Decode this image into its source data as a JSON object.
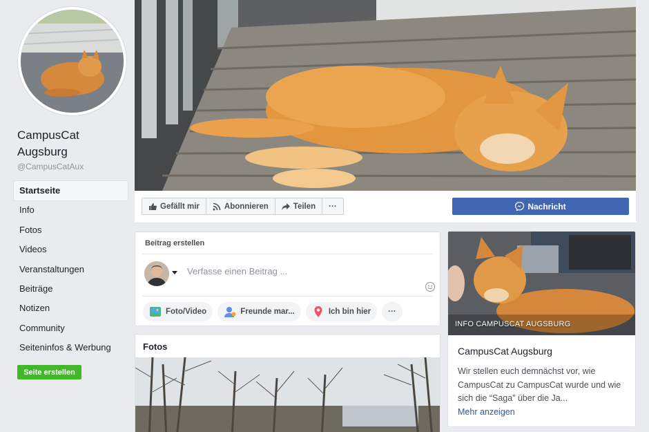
{
  "page": {
    "name": "CampusCat Augsburg",
    "handle": "@CampusCatAux"
  },
  "sidebar": {
    "items": [
      {
        "label": "Startseite",
        "active": true
      },
      {
        "label": "Info"
      },
      {
        "label": "Fotos"
      },
      {
        "label": "Videos"
      },
      {
        "label": "Veranstaltungen"
      },
      {
        "label": "Beiträge"
      },
      {
        "label": "Notizen"
      },
      {
        "label": "Community"
      },
      {
        "label": "Seiteninfos & Werbung"
      }
    ],
    "create_button": "Seite erstellen"
  },
  "actions": {
    "like": "Gefällt mir",
    "follow": "Abonnieren",
    "share": "Teilen",
    "more": "···",
    "message": "Nachricht"
  },
  "composer": {
    "title": "Beitrag erstellen",
    "placeholder": "Verfasse einen Beitrag ...",
    "chips": [
      {
        "label": "Foto/Video",
        "icon": "photo-icon"
      },
      {
        "label": "Freunde mar...",
        "icon": "tag-friends-icon"
      },
      {
        "label": "Ich bin hier",
        "icon": "location-pin-icon"
      }
    ],
    "more": "···"
  },
  "photos": {
    "title": "Fotos"
  },
  "info": {
    "overlay": "INFO CAMPUSCAT AUGSBURG",
    "title": "CampusCat Augsburg",
    "description": "Wir stellen euch demnächst vor, wie CampusCat zu CampusCat wurde und wie sich die “Saga” über die Ja...",
    "more": "Mehr anzeigen"
  },
  "colors": {
    "background": "#e9ebee",
    "primary": "#4267b2",
    "create_green": "#42b72a",
    "link": "#365899"
  }
}
